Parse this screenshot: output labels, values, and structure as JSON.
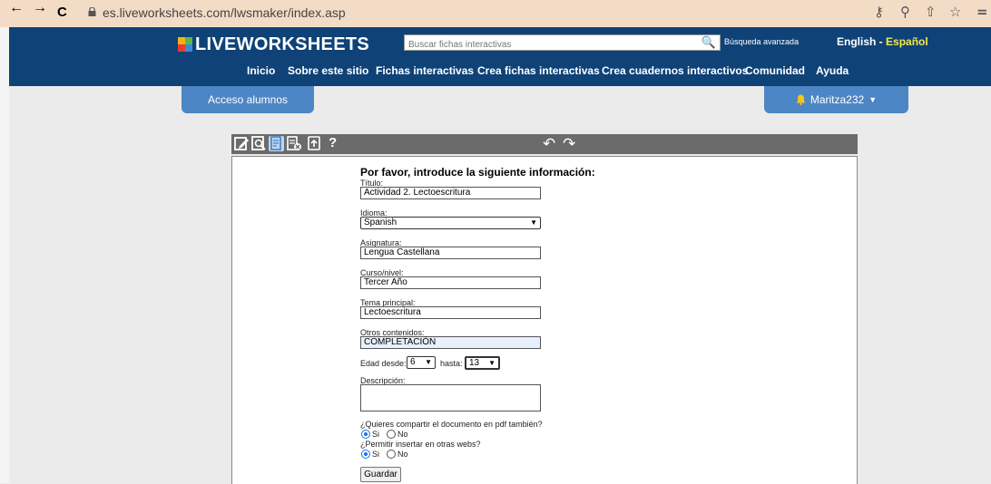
{
  "browser": {
    "url": "es.liveworksheets.com/lwsmaker/index.asp",
    "back_icon": "arrow-left-icon",
    "forward_icon": "arrow-right-icon",
    "reload_icon": "reload-icon",
    "nav_glyphs": {
      "back": "←",
      "forward": "→",
      "reload": "C"
    },
    "right_icons": {
      "key": "⚷",
      "zoom": "⚲",
      "share": "⇧",
      "star": "☆",
      "menu": "="
    }
  },
  "header": {
    "logo": "LIVEWORKSHEETS",
    "logo_colors": [
      "#f2b21c",
      "#58b947",
      "#e53e30",
      "#3b8ad9"
    ],
    "search_placeholder": "Buscar fichas interactivas",
    "search_icon": "🔍",
    "advanced_search": "Búsqueda avanzada",
    "lang_en": "English",
    "lang_sep": " - ",
    "lang_es": "Español",
    "menu": [
      "Inicio",
      "Sobre este sitio",
      "Fichas interactivas",
      "Crea fichas interactivas",
      "Crea cuadernos interactivos",
      "Comunidad",
      "Ayuda"
    ]
  },
  "subbar": {
    "students": "Acceso alumnos",
    "user": "Maritza232",
    "caret": "▼"
  },
  "toolbar": {
    "tools": [
      "edit-icon",
      "preview-icon",
      "set-answers-icon",
      "delete-page-icon",
      "export-icon"
    ],
    "help": "?",
    "undo": "↶",
    "redo": "↷"
  },
  "form": {
    "heading": "Por favor, introduce la siguiente información:",
    "titulo_label": "Título:",
    "titulo_value": "Actividad 2. Lectoescritura",
    "idioma_label": "Idioma:",
    "idioma_value": "Spanish",
    "asignatura_label": "Asignatura:",
    "asignatura_value": "Lengua Castellana",
    "curso_label": "Curso/nivel:",
    "curso_value": "Tercer Año",
    "tema_label": "Tema principal:",
    "tema_value": "Lectoescritura",
    "otros_label": "Otros contenidos:",
    "otros_value": "COMPLETACIÓN",
    "edad_desde_label": "Edad desde:",
    "edad_desde_value": "6",
    "edad_hasta_label": "hasta:",
    "edad_hasta_value": "13",
    "descripcion_label": "Descripción:",
    "pdf_question": "¿Quieres compartir el documento en pdf también?",
    "embed_question": "¿Permitir insertar en otras webs?",
    "yes": "Si",
    "no": "No",
    "pdf_selected": "Si",
    "embed_selected": "Si",
    "save": "Guardar",
    "caret": "▼"
  }
}
